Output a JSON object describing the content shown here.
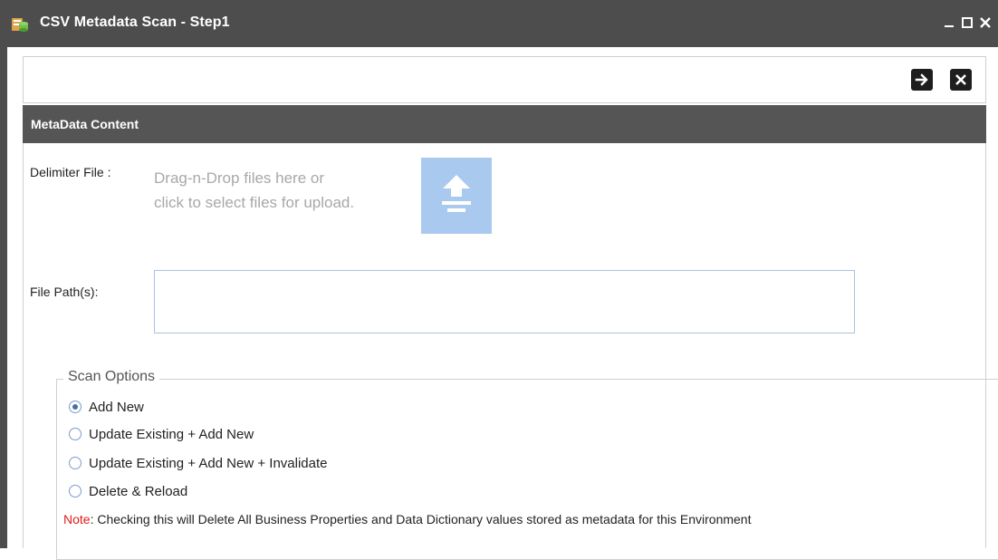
{
  "window": {
    "title": "CSV Metadata Scan - Step1",
    "icons": {
      "app": "app-database-icon",
      "minimize": "minimize-icon",
      "maximize": "maximize-icon",
      "close": "close-icon"
    }
  },
  "toolbar": {
    "next_icon": "arrow-right-icon",
    "close_icon": "close-square-icon"
  },
  "section": {
    "title": "MetaData Content"
  },
  "form": {
    "delimiter_label": "Delimiter File :",
    "dropzone_line1": "Drag-n-Drop files here or",
    "dropzone_line2": "click to select files for upload.",
    "upload_icon": "upload-icon",
    "file_path_label": "File Path(s):",
    "file_path_value": ""
  },
  "scan_options": {
    "legend": "Scan Options",
    "options": [
      {
        "label": "Add New",
        "selected": true
      },
      {
        "label": "Update Existing + Add New",
        "selected": false
      },
      {
        "label": "Update Existing + Add New + Invalidate",
        "selected": false
      },
      {
        "label": "Delete & Reload",
        "selected": false
      }
    ],
    "note_key": "Note",
    "note_text": ": Checking this will Delete All Business Properties and Data Dictionary values stored as metadata for this Environment"
  },
  "colors": {
    "titlebar": "#4d4d4d",
    "section_header": "#555555",
    "upload_button": "#aac9ee",
    "note_key": "#e21b1b"
  }
}
